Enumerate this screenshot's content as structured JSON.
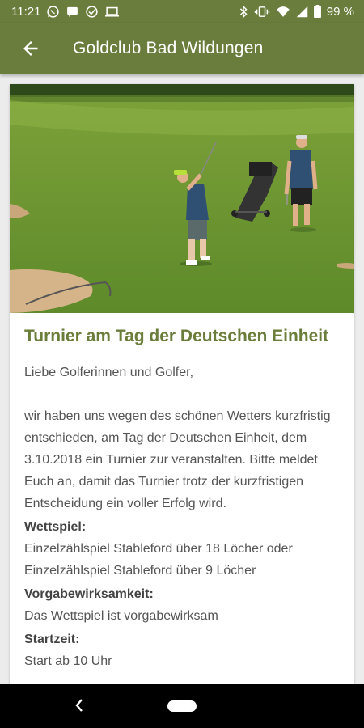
{
  "status": {
    "time": "11:21",
    "battery": "99 %"
  },
  "app_bar": {
    "title": "Goldclub Bad Wildungen"
  },
  "article": {
    "title": "Turnier am Tag der Deutschen Einheit",
    "greeting": "Liebe Golferinnen und Golfer,",
    "intro": "wir haben uns wegen des schönen Wetters kurzfristig entschieden, am Tag der Deutschen Einheit, dem 3.10.2018 ein Turnier zur veranstalten. Bitte meldet Euch an, damit das Turnier trotz der kurzfristigen Entscheidung ein voller Erfolg wird.",
    "wettspiel_label": "Wettspiel:",
    "wettspiel_text": "Einzelzählspiel Stableford über 18 Löcher oder Einzelzählspiel Stableford über 9 Löcher",
    "vorgabe_label": "Vorgabewirksamkeit:",
    "vorgabe_text": "Das Wettspiel ist vorgabewirksam",
    "startzeit_label": "Startzeit:",
    "startzeit_text": "Start ab 10 Uhr"
  },
  "colors": {
    "brand": "#6a7d3c",
    "title_green": "#6b7d3a"
  },
  "icons": [
    "whatsapp-icon",
    "message-icon",
    "check-circle-icon",
    "laptop-icon",
    "bluetooth-icon",
    "vibrate-icon",
    "wifi-icon",
    "signal-icon",
    "battery-icon",
    "back-arrow-icon"
  ]
}
